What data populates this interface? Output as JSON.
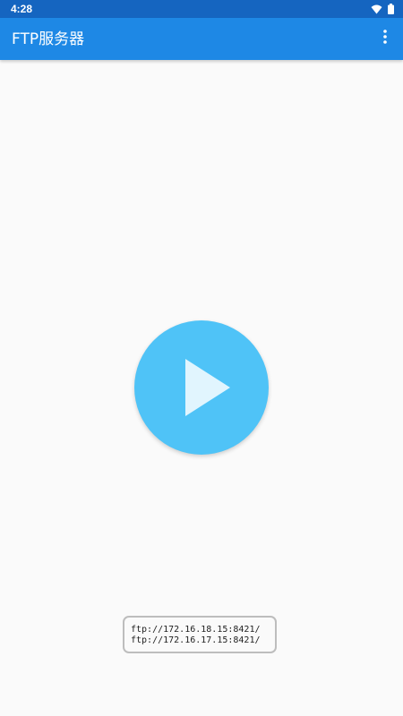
{
  "status_bar": {
    "time": "4:28",
    "icons": [
      "wifi-icon",
      "battery-icon"
    ]
  },
  "app_bar": {
    "title": "FTP服务器",
    "menu_icon": "more-vert-icon"
  },
  "main": {
    "play_icon": "play-icon",
    "addresses": [
      "ftp://172.16.18.15:8421/",
      "ftp://172.16.17.15:8421/"
    ]
  },
  "colors": {
    "status_bar": "#1565c0",
    "app_bar": "#1e88e5",
    "play_button": "#4fc3f7",
    "play_glyph": "#e1f5fe",
    "background": "#fafafa"
  }
}
